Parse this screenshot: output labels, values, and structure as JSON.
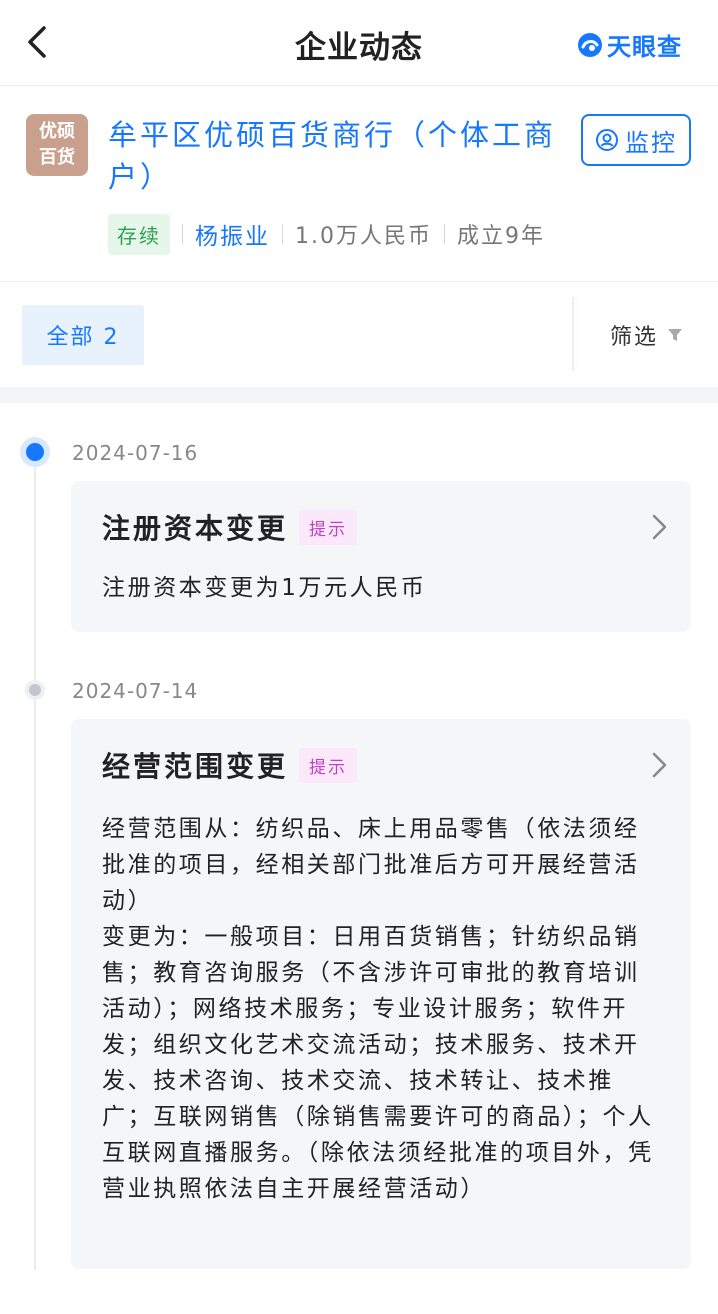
{
  "nav": {
    "title": "企业动态",
    "brand": "天眼查"
  },
  "company": {
    "logo_line1": "优硕",
    "logo_line2": "百货",
    "name": "牟平区优硕百货商行（个体工商户）",
    "monitor_label": "监控",
    "status": "存续",
    "legal_rep": "杨振业",
    "capital": "1.0万人民币",
    "established": "成立9年"
  },
  "filter": {
    "tab_all": "全部 2",
    "filter_label": "筛选"
  },
  "events": [
    {
      "date": "2024-07-16",
      "title": "注册资本变更",
      "tag": "提示",
      "body": "注册资本变更为1万元人民币"
    },
    {
      "date": "2024-07-14",
      "title": "经营范围变更",
      "tag": "提示",
      "body": "经营范围从：纺织品、床上用品零售（依法须经批准的项目，经相关部门批准后方可开展经营活动）\n变更为：一般项目：日用百货销售；针纺织品销售；教育咨询服务（不含涉许可审批的教育培训活动）；网络技术服务；专业设计服务；软件开发；组织文化艺术交流活动；技术服务、技术开发、技术咨询、技术交流、技术转让、技术推广；互联网销售（除销售需要许可的商品）；个人互联网直播服务。（除依法须经批准的项目外，凭营业执照依法自主开展经营活动）"
    }
  ],
  "colors": {
    "accent": "#1677ff",
    "status_green": "#2ca24f",
    "tag_purple": "#c040c8",
    "logo_bg": "#c9a08e"
  }
}
